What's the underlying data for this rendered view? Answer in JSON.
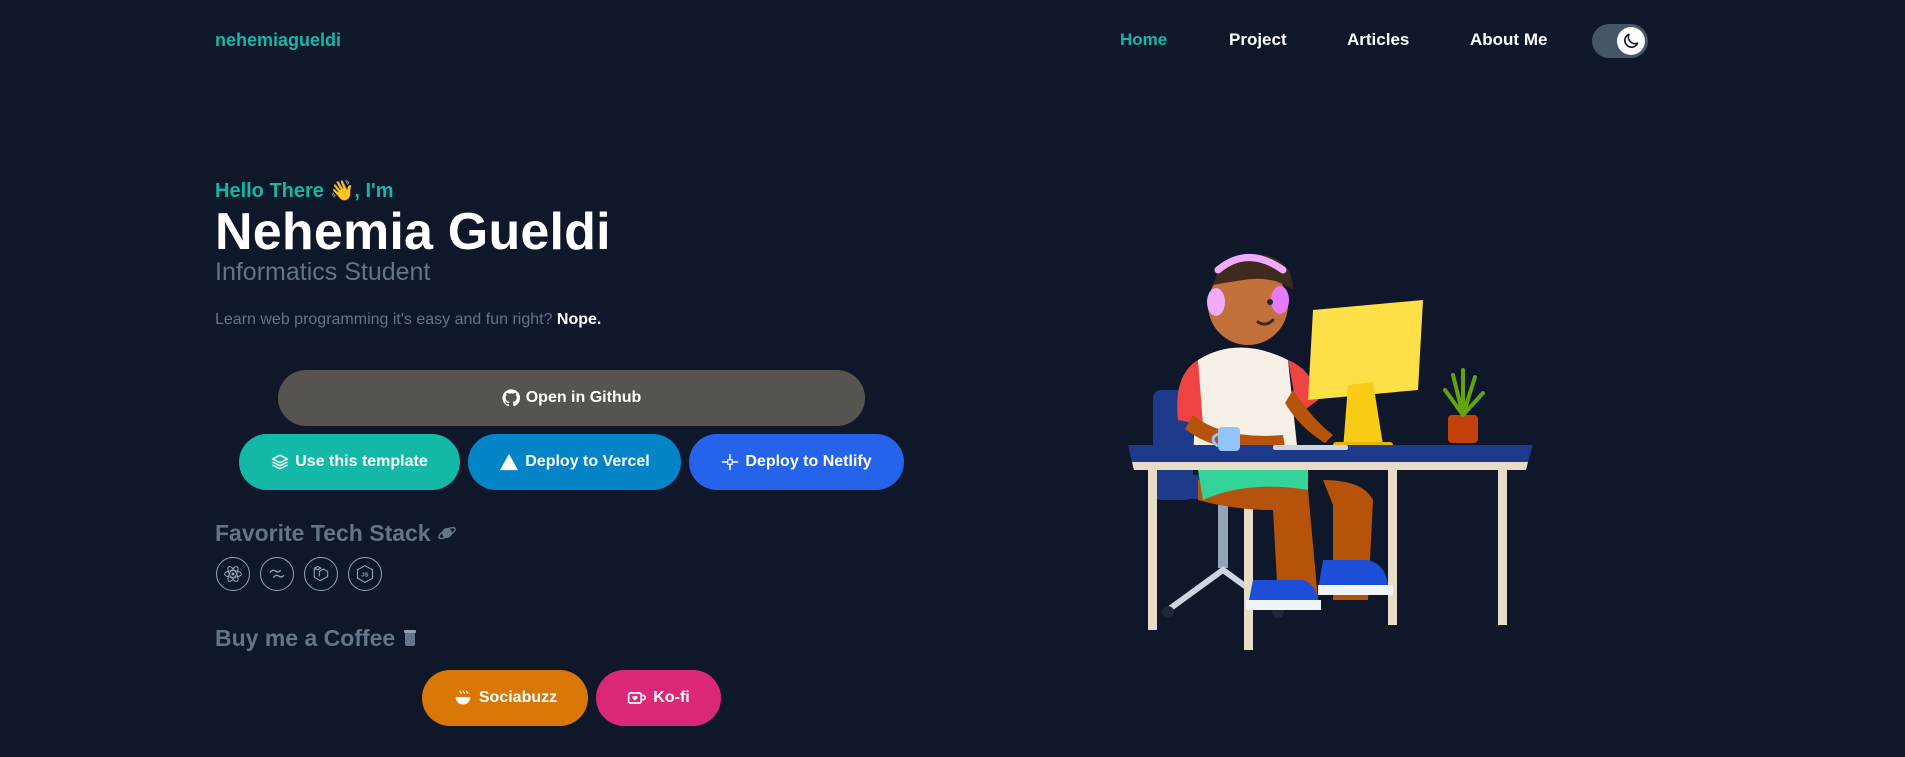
{
  "brand": "nehemiagueldi",
  "nav": {
    "home": "Home",
    "project": "Project",
    "articles": "Articles",
    "about": "About Me",
    "active": "Home"
  },
  "theme_toggle": {
    "icon": "moon-icon",
    "state": "dark"
  },
  "hero": {
    "greeting": "Hello There 👋, I'm",
    "name": "Nehemia Gueldi",
    "role": "Informatics Student",
    "tagline": "Learn web programming it's easy and fun right?",
    "tagline_strong": "Nope."
  },
  "buttons": {
    "github": "Open in Github",
    "template": "Use this template",
    "vercel": "Deploy to Vercel",
    "netlify": "Deploy to Netlify"
  },
  "tech_stack": {
    "title": "Favorite Tech Stack",
    "icons": [
      "react-icon",
      "tailwind-icon",
      "laravel-icon",
      "nodejs-icon"
    ]
  },
  "coffee": {
    "title": "Buy me a Coffee",
    "sociabuzz": "Sociabuzz",
    "kofi": "Ko-fi"
  },
  "colors": {
    "background": "#0f172a",
    "accent": "#14b8a6",
    "muted": "#64748b",
    "github": "#57534e",
    "vercel": "#0284c7",
    "netlify": "#2563eb",
    "sociabuzz": "#d97706",
    "kofi": "#db2777"
  }
}
